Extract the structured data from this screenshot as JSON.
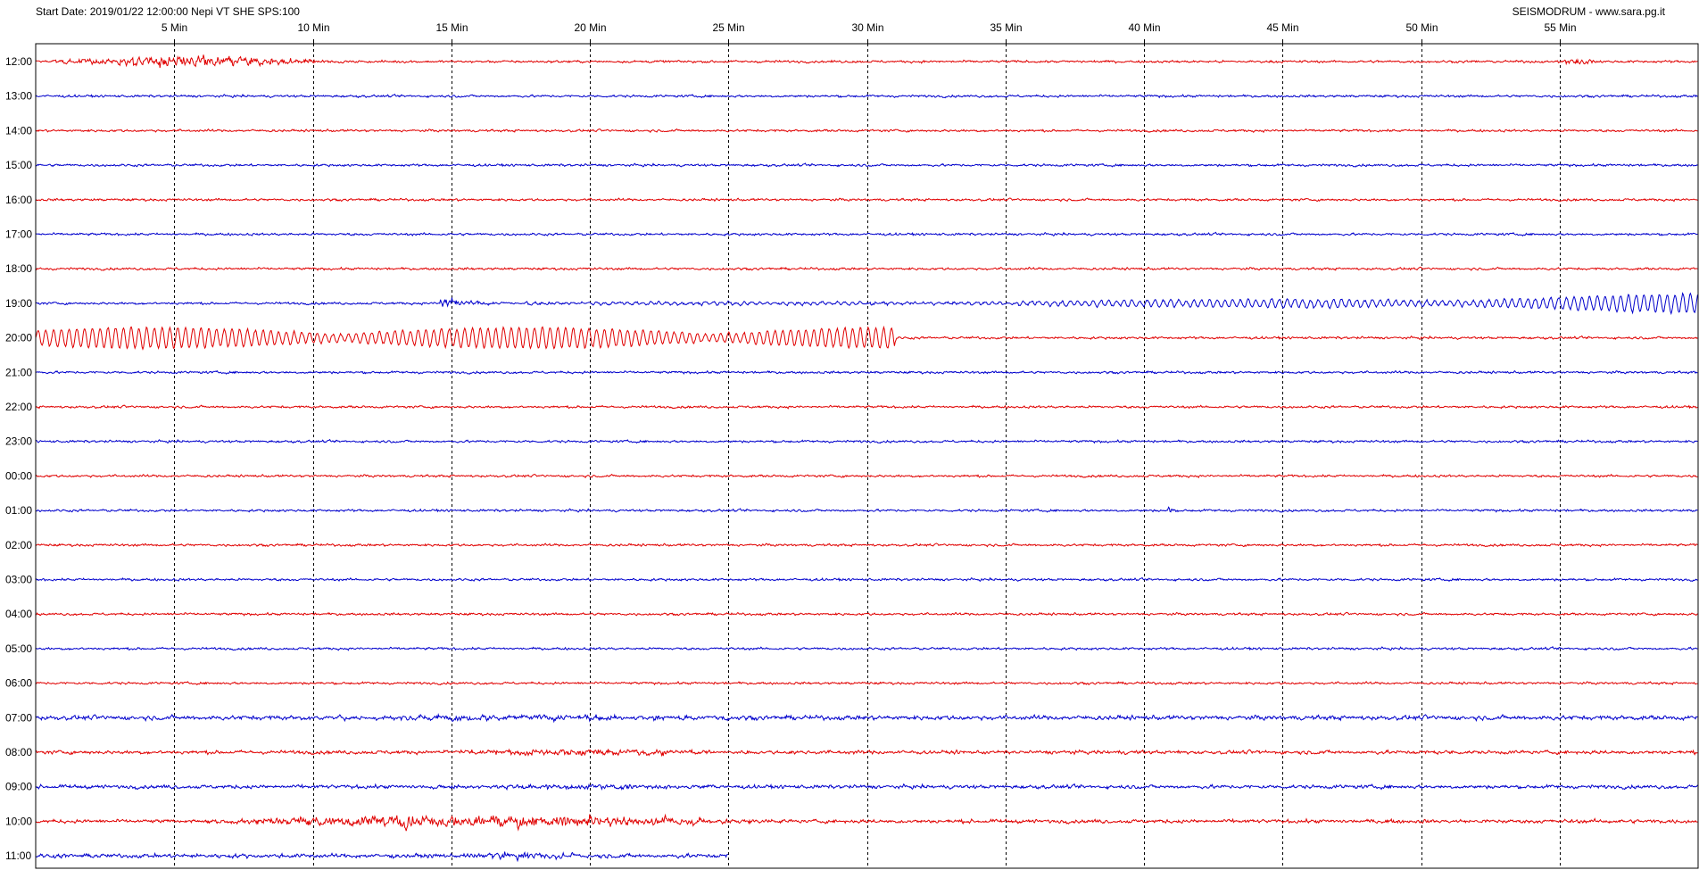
{
  "header": {
    "start_info": "Start Date: 2019/01/22 12:00:00  Nepi VT SHE SPS:100",
    "brand": "SEISMODRUM - www.sara.pg.it"
  },
  "colors": {
    "trace_odd": "#e00000",
    "trace_even": "#0000cc",
    "gridline": "#000000",
    "frame": "#000000",
    "background": "#ffffff"
  },
  "chart_data": {
    "type": "line",
    "title": "",
    "xlabel": "",
    "ylabel": "",
    "x_unit": "Min",
    "xlim": [
      0,
      60
    ],
    "x_ticks": [
      {
        "value": 5,
        "label": "5 Min"
      },
      {
        "value": 10,
        "label": "10 Min"
      },
      {
        "value": 15,
        "label": "15 Min"
      },
      {
        "value": 20,
        "label": "20 Min"
      },
      {
        "value": 25,
        "label": "25 Min"
      },
      {
        "value": 30,
        "label": "30 Min"
      },
      {
        "value": 35,
        "label": "35 Min"
      },
      {
        "value": 40,
        "label": "40 Min"
      },
      {
        "value": 45,
        "label": "45 Min"
      },
      {
        "value": 50,
        "label": "50 Min"
      },
      {
        "value": 55,
        "label": "55 Min"
      }
    ],
    "grid": "vertical dashed at each tick",
    "legend": "none",
    "rows": [
      {
        "label": "12:00",
        "color": "red",
        "noise": 0.3,
        "end_min": 60,
        "events": [
          {
            "type": "burst",
            "start": 0,
            "end": 11.5,
            "amp": 1.6
          },
          {
            "type": "burst",
            "start": 54.5,
            "end": 56.5,
            "amp": 0.9
          }
        ]
      },
      {
        "label": "13:00",
        "color": "blue",
        "noise": 0.3,
        "end_min": 60,
        "events": []
      },
      {
        "label": "14:00",
        "color": "red",
        "noise": 0.3,
        "end_min": 60,
        "events": []
      },
      {
        "label": "15:00",
        "color": "blue",
        "noise": 0.3,
        "end_min": 60,
        "events": []
      },
      {
        "label": "16:00",
        "color": "red",
        "noise": 0.3,
        "end_min": 60,
        "events": []
      },
      {
        "label": "17:00",
        "color": "blue",
        "noise": 0.3,
        "end_min": 60,
        "events": []
      },
      {
        "label": "18:00",
        "color": "red",
        "noise": 0.3,
        "end_min": 60,
        "events": []
      },
      {
        "label": "19:00",
        "color": "blue",
        "noise": 0.3,
        "end_min": 60,
        "events": [
          {
            "type": "quake_onset",
            "start": 14.6,
            "end": 17.5,
            "amp": 2.2
          },
          {
            "type": "surface_wave",
            "start": 17.5,
            "end": 60,
            "amp": 1.9
          }
        ]
      },
      {
        "label": "20:00",
        "color": "red",
        "noise": 0.3,
        "end_min": 60,
        "events": [
          {
            "type": "surface_wave",
            "start": 0,
            "end": 31,
            "amp": 2.0
          }
        ]
      },
      {
        "label": "21:00",
        "color": "blue",
        "noise": 0.3,
        "end_min": 60,
        "events": []
      },
      {
        "label": "22:00",
        "color": "red",
        "noise": 0.3,
        "end_min": 60,
        "events": []
      },
      {
        "label": "23:00",
        "color": "blue",
        "noise": 0.3,
        "end_min": 60,
        "events": []
      },
      {
        "label": "00:00",
        "color": "red",
        "noise": 0.3,
        "end_min": 60,
        "events": []
      },
      {
        "label": "01:00",
        "color": "blue",
        "noise": 0.3,
        "end_min": 60,
        "events": [
          {
            "type": "spike",
            "start": 40.8,
            "end": 41.1,
            "amp": 1.0
          }
        ]
      },
      {
        "label": "02:00",
        "color": "red",
        "noise": 0.3,
        "end_min": 60,
        "events": []
      },
      {
        "label": "03:00",
        "color": "blue",
        "noise": 0.3,
        "end_min": 60,
        "events": []
      },
      {
        "label": "04:00",
        "color": "red",
        "noise": 0.3,
        "end_min": 60,
        "events": []
      },
      {
        "label": "05:00",
        "color": "blue",
        "noise": 0.3,
        "end_min": 60,
        "events": []
      },
      {
        "label": "06:00",
        "color": "red",
        "noise": 0.3,
        "end_min": 60,
        "events": []
      },
      {
        "label": "07:00",
        "color": "blue",
        "noise": 0.55,
        "end_min": 60,
        "events": [
          {
            "type": "burst",
            "start": 9.5,
            "end": 25,
            "amp": 0.7
          }
        ]
      },
      {
        "label": "08:00",
        "color": "red",
        "noise": 0.45,
        "end_min": 60,
        "events": [
          {
            "type": "burst",
            "start": 14,
            "end": 25,
            "amp": 1.0
          }
        ]
      },
      {
        "label": "09:00",
        "color": "blue",
        "noise": 0.45,
        "end_min": 60,
        "events": [
          {
            "type": "burst",
            "start": 14,
            "end": 25,
            "amp": 0.6
          }
        ]
      },
      {
        "label": "10:00",
        "color": "red",
        "noise": 0.45,
        "end_min": 60,
        "events": [
          {
            "type": "burst",
            "start": 5,
            "end": 27,
            "amp": 2.0
          }
        ]
      },
      {
        "label": "11:00",
        "color": "blue",
        "noise": 0.5,
        "end_min": 25,
        "events": [
          {
            "type": "burst",
            "start": 15,
            "end": 20,
            "amp": 1.0
          }
        ]
      }
    ]
  }
}
